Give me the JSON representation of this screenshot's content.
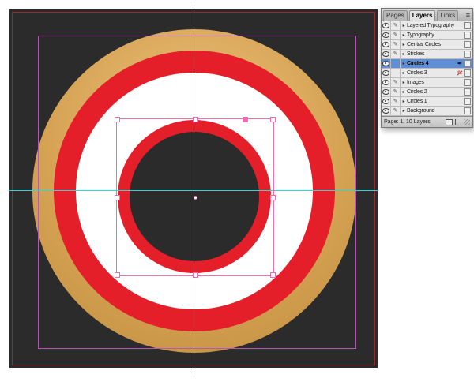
{
  "canvas": {
    "background": "#2b2b2b",
    "bleed_guide_color": "#8e2f2f",
    "ruler_guide_color": "#2ad6d6",
    "margin_guide_color": "#b35ab3",
    "selection_color": "#ef6db7",
    "ring_colors": {
      "gold": "#d6a355",
      "red": "#e51f2a",
      "white": "#ffffff",
      "center": "#2b2b2b"
    }
  },
  "panel": {
    "tabs": [
      "Pages",
      "Layers",
      "Links"
    ],
    "active_tab": "Layers",
    "icons": {
      "expand": "▸",
      "lock_pencil": "✎",
      "no_edit_pencil": "✎",
      "pen": "✒",
      "menu": "≡"
    },
    "layers": [
      {
        "name": "Layered Typography",
        "visible": true,
        "locked": true
      },
      {
        "name": "Typography",
        "visible": true,
        "locked": true
      },
      {
        "name": "Central Circles",
        "visible": true,
        "locked": true
      },
      {
        "name": "Strokes",
        "visible": true,
        "locked": true
      },
      {
        "name": "Circles 4",
        "visible": true,
        "locked": false,
        "selected": true,
        "badge": "pen"
      },
      {
        "name": "Circles 3",
        "visible": true,
        "locked": false,
        "badge": "no-edit"
      },
      {
        "name": "Images",
        "visible": true,
        "locked": true
      },
      {
        "name": "Circles 2",
        "visible": true,
        "locked": true
      },
      {
        "name": "Circles 1",
        "visible": true,
        "locked": true
      },
      {
        "name": "Background",
        "visible": true,
        "locked": true
      }
    ],
    "status": "Page: 1, 10 Layers"
  }
}
